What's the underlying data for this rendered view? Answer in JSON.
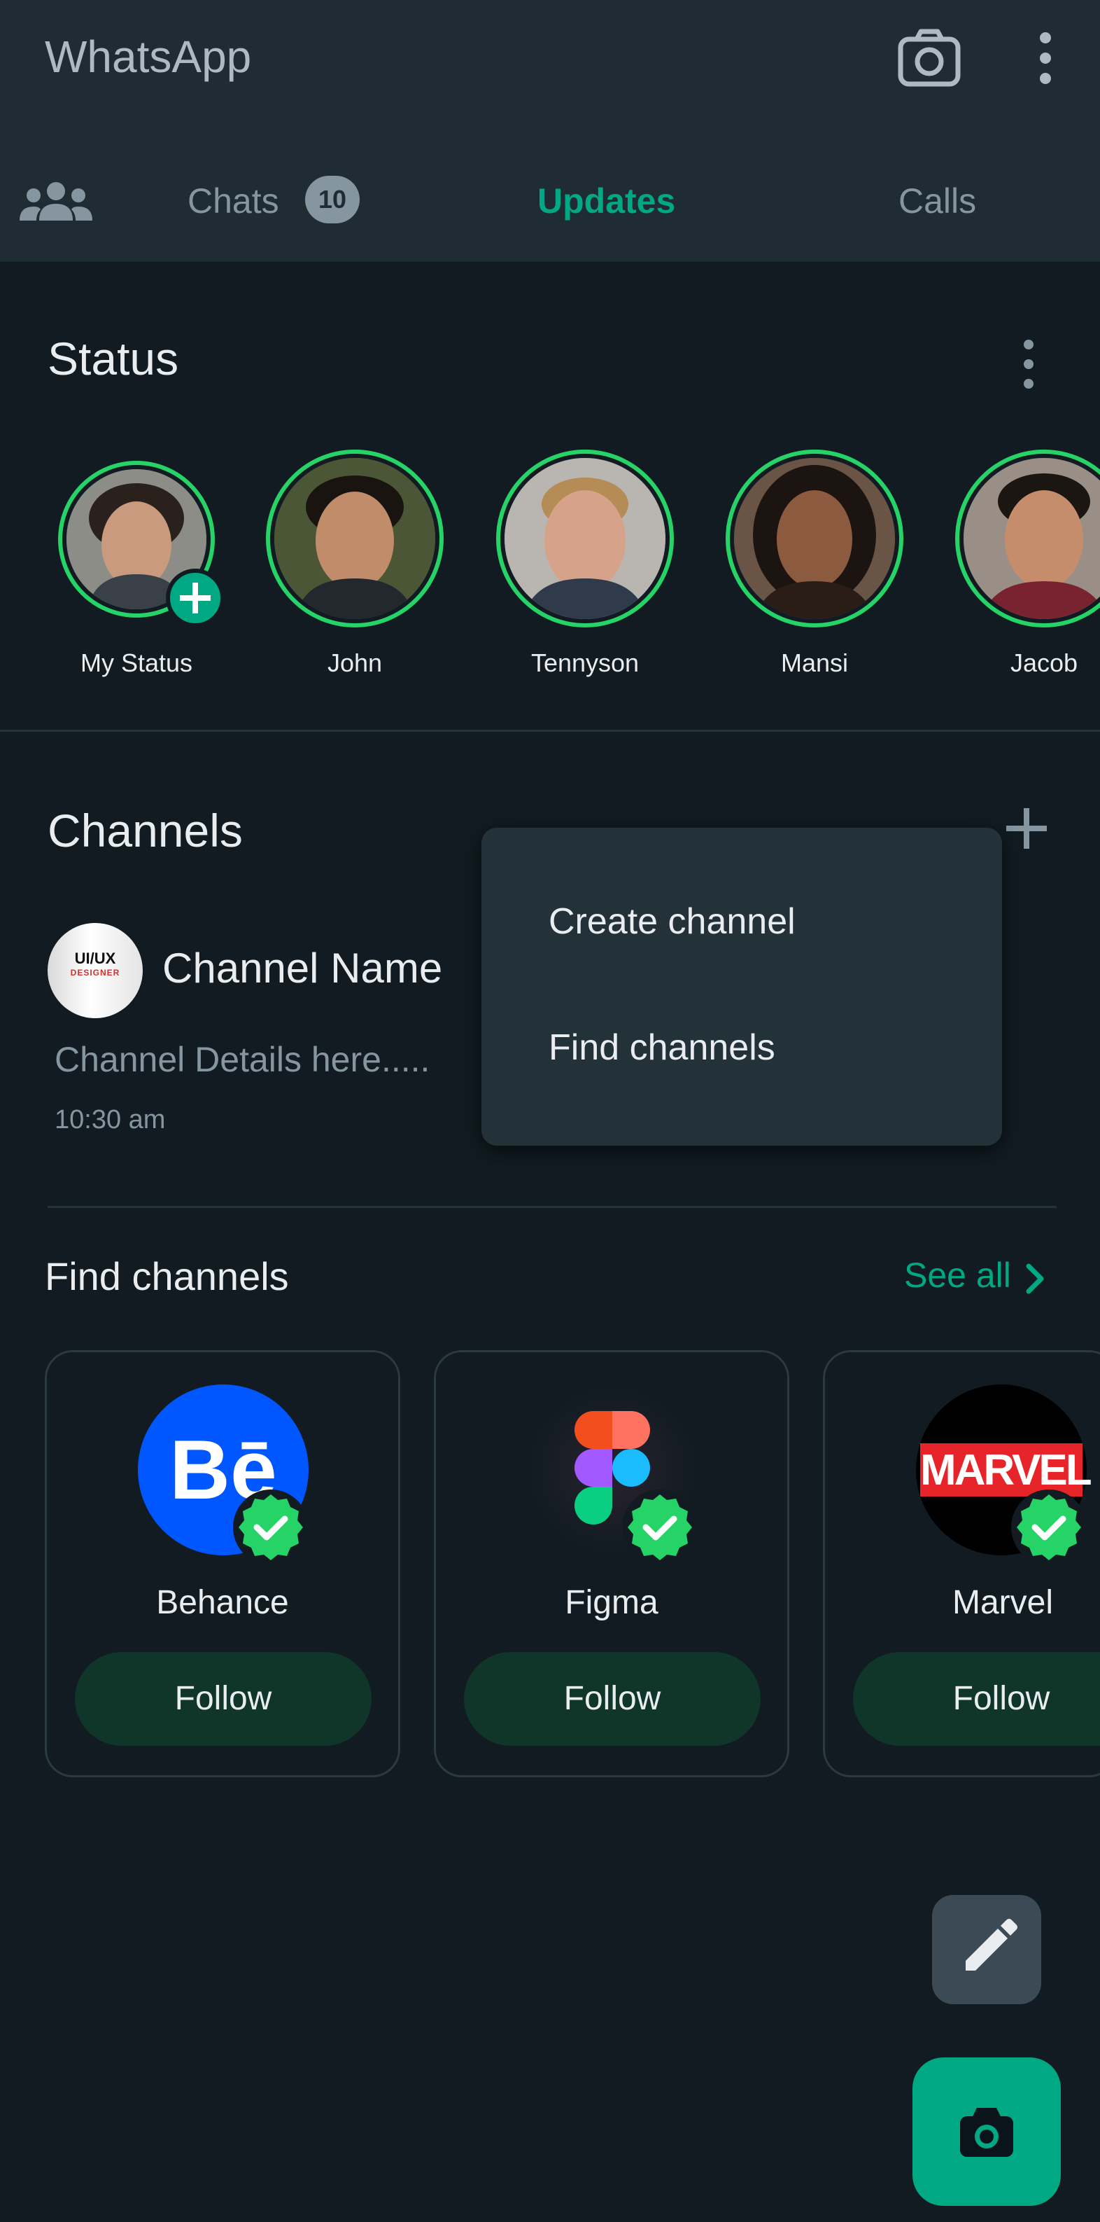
{
  "header": {
    "app_title": "WhatsApp",
    "camera_icon": "camera-icon",
    "menu_icon": "more-vert-icon"
  },
  "tabs": {
    "community_icon": "community-icon",
    "chats_label": "Chats",
    "chats_badge": "10",
    "updates_label": "Updates",
    "calls_label": "Calls",
    "active": "Updates"
  },
  "status": {
    "title": "Status",
    "items": [
      {
        "name": "My Status",
        "add_icon": "add-icon"
      },
      {
        "name": "John"
      },
      {
        "name": "Tennyson"
      },
      {
        "name": "Mansi"
      },
      {
        "name": "Jacob"
      }
    ]
  },
  "channels": {
    "title": "Channels",
    "channel": {
      "avatar_text_line1": "UI/UX",
      "avatar_text_line2": "DESIGNER",
      "name": "Channel Name",
      "details": "Channel Details here.....",
      "time": "10:30 am"
    }
  },
  "menu": {
    "items": [
      "Create channel",
      "Find channels"
    ]
  },
  "find_channels": {
    "title": "Find channels",
    "see_all": "See all",
    "cards": [
      {
        "name": "Behance",
        "logo_text": "Bē",
        "button": "Follow"
      },
      {
        "name": "Figma",
        "button": "Follow"
      },
      {
        "name": "Marvel",
        "logo_text": "MARVEL",
        "button": "Follow"
      }
    ]
  },
  "colors": {
    "accent": "#00a884",
    "status_ring": "#25d366",
    "background": "#111b21",
    "header": "#1f2c34",
    "behance_blue": "#0057ff",
    "marvel_red": "#e62429",
    "follow_bg": "#103529"
  }
}
